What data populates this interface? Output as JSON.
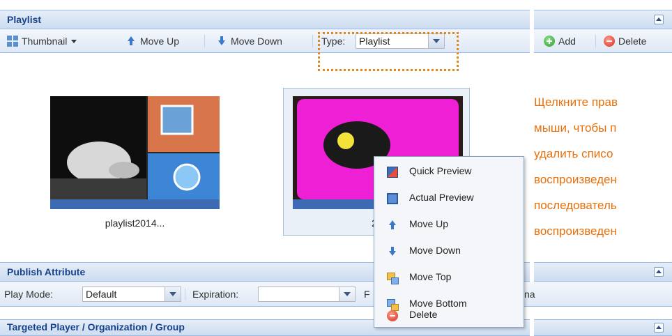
{
  "playlist_panel": {
    "title": "Playlist",
    "toolbar": {
      "thumbnail_label": "Thumbnail",
      "move_up_label": "Move Up",
      "move_down_label": "Move Down",
      "type_label": "Type:",
      "type_value": "Playlist",
      "add_label": "Add",
      "delete_label": "Delete"
    },
    "items": [
      {
        "caption": "playlist2014..."
      },
      {
        "caption": "2"
      }
    ]
  },
  "context_menu": {
    "items": [
      {
        "label": "Quick Preview",
        "icon": "quick-preview-icon"
      },
      {
        "label": "Actual Preview",
        "icon": "monitor-icon"
      },
      {
        "label": "Move Up",
        "icon": "arrow-up-icon"
      },
      {
        "label": "Move Down",
        "icon": "arrow-down-icon"
      },
      {
        "label": "Move Top",
        "icon": "move-top-icon"
      },
      {
        "label": "Move Bottom",
        "icon": "move-bottom-icon"
      },
      {
        "label": "Delete",
        "icon": "delete-icon"
      }
    ]
  },
  "publish_panel": {
    "title": "Publish Attribute",
    "play_mode_label": "Play Mode:",
    "play_mode_value": "Default",
    "expiration_label": "Expiration:",
    "expiration_value": "",
    "truncated_label": "F",
    "truncated_right": "na"
  },
  "targeted_panel": {
    "title": "Targeted Player / Organization / Group"
  },
  "annotation": {
    "lines": [
      "Щелкните прав",
      "мыши, чтобы п",
      "удалить списо",
      "воспроизведен",
      "последователь",
      "воспроизведен"
    ]
  },
  "colors": {
    "header_text": "#15428b",
    "annotation": "#e8700c",
    "highlight_border": "#e08a1e"
  }
}
